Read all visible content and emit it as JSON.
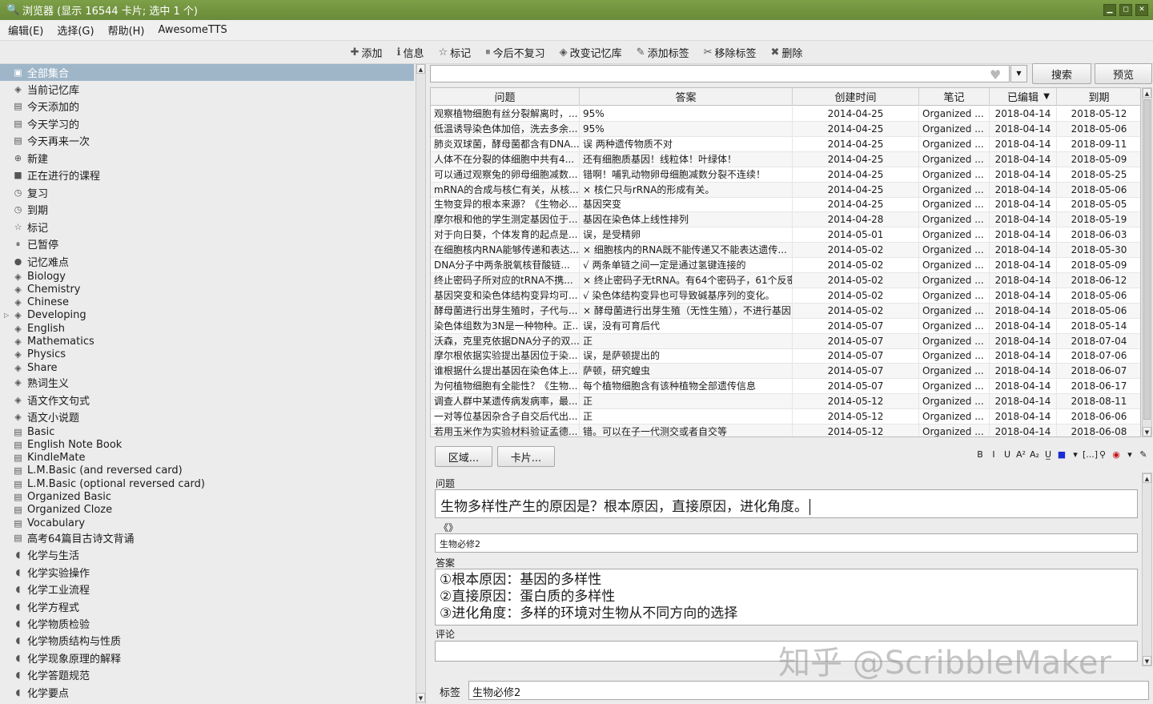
{
  "window": {
    "title": "浏览器 (显示 16544 卡片; 选中 1 个)"
  },
  "menu": [
    "编辑(E)",
    "选择(G)",
    "帮助(H)",
    "AwesomeTTS"
  ],
  "toolbar": [
    {
      "label": "添加",
      "icon": "add-icon",
      "glyph": "✚"
    },
    {
      "label": "信息",
      "icon": "info-icon",
      "glyph": "ℹ"
    },
    {
      "label": "标记",
      "icon": "star-icon",
      "glyph": "☆"
    },
    {
      "label": "今后不复习",
      "icon": "pause-icon",
      "glyph": "⏸"
    },
    {
      "label": "改变记忆库",
      "icon": "deck-icon",
      "glyph": "◈"
    },
    {
      "label": "添加标签",
      "icon": "tag-add-icon",
      "glyph": "✎"
    },
    {
      "label": "移除标签",
      "icon": "tag-remove-icon",
      "glyph": "✂"
    },
    {
      "label": "删除",
      "icon": "delete-icon",
      "glyph": "✖"
    }
  ],
  "sidebar": [
    {
      "label": "全部集合",
      "glyph": "▣",
      "icon": "collection-icon",
      "selected": true
    },
    {
      "label": "当前记忆库",
      "glyph": "◈",
      "icon": "deck-icon"
    },
    {
      "label": "今天添加的",
      "glyph": "▤",
      "icon": "calendar-icon"
    },
    {
      "label": "今天学习的",
      "glyph": "▤",
      "icon": "calendar-icon"
    },
    {
      "label": "今天再来一次",
      "glyph": "▤",
      "icon": "calendar-icon"
    },
    {
      "label": "新建",
      "glyph": "⊕",
      "icon": "new-icon"
    },
    {
      "label": "正在进行的课程",
      "glyph": "■",
      "icon": "course-icon"
    },
    {
      "label": "复习",
      "glyph": "◷",
      "icon": "clock-icon"
    },
    {
      "label": "到期",
      "glyph": "◷",
      "icon": "clock-icon"
    },
    {
      "label": "标记",
      "glyph": "☆",
      "icon": "star-icon"
    },
    {
      "label": "已暂停",
      "glyph": "⏸",
      "icon": "pause-icon"
    },
    {
      "label": "记忆难点",
      "glyph": "●",
      "icon": "leech-icon"
    },
    {
      "label": "Biology",
      "glyph": "◈",
      "icon": "deck-icon"
    },
    {
      "label": "Chemistry",
      "glyph": "◈",
      "icon": "deck-icon"
    },
    {
      "label": "Chinese",
      "glyph": "◈",
      "icon": "deck-icon"
    },
    {
      "label": "Developing",
      "glyph": "◈",
      "icon": "deck-icon",
      "expander": "▷"
    },
    {
      "label": "English",
      "glyph": "◈",
      "icon": "deck-icon"
    },
    {
      "label": "Mathematics",
      "glyph": "◈",
      "icon": "deck-icon"
    },
    {
      "label": "Physics",
      "glyph": "◈",
      "icon": "deck-icon"
    },
    {
      "label": "Share",
      "glyph": "◈",
      "icon": "deck-icon"
    },
    {
      "label": "熟词生义",
      "glyph": "◈",
      "icon": "deck-icon"
    },
    {
      "label": "语文作文句式",
      "glyph": "◈",
      "icon": "deck-icon"
    },
    {
      "label": "语文小说题",
      "glyph": "◈",
      "icon": "deck-icon"
    },
    {
      "label": "Basic",
      "glyph": "▤",
      "icon": "note-type-icon"
    },
    {
      "label": "English Note Book",
      "glyph": "▤",
      "icon": "note-type-icon"
    },
    {
      "label": "KindleMate",
      "glyph": "▤",
      "icon": "note-type-icon"
    },
    {
      "label": "L.M.Basic (and reversed card)",
      "glyph": "▤",
      "icon": "note-type-icon"
    },
    {
      "label": "L.M.Basic (optional reversed card)",
      "glyph": "▤",
      "icon": "note-type-icon"
    },
    {
      "label": "Organized Basic",
      "glyph": "▤",
      "icon": "note-type-icon"
    },
    {
      "label": "Organized Cloze",
      "glyph": "▤",
      "icon": "note-type-icon"
    },
    {
      "label": "Vocabulary",
      "glyph": "▤",
      "icon": "note-type-icon"
    },
    {
      "label": "高考64篇目古诗文背诵",
      "glyph": "▤",
      "icon": "note-type-icon"
    },
    {
      "label": "化学与生活",
      "glyph": "◖",
      "icon": "tag-icon"
    },
    {
      "label": "化学实验操作",
      "glyph": "◖",
      "icon": "tag-icon"
    },
    {
      "label": "化学工业流程",
      "glyph": "◖",
      "icon": "tag-icon"
    },
    {
      "label": "化学方程式",
      "glyph": "◖",
      "icon": "tag-icon"
    },
    {
      "label": "化学物质检验",
      "glyph": "◖",
      "icon": "tag-icon"
    },
    {
      "label": "化学物质结构与性质",
      "glyph": "◖",
      "icon": "tag-icon"
    },
    {
      "label": "化学现象原理的解释",
      "glyph": "◖",
      "icon": "tag-icon"
    },
    {
      "label": "化学答题规范",
      "glyph": "◖",
      "icon": "tag-icon"
    },
    {
      "label": "化学要点",
      "glyph": "◖",
      "icon": "tag-icon"
    }
  ],
  "search": {
    "value": "",
    "search_label": "搜索",
    "preview_label": "预览"
  },
  "table": {
    "columns": [
      "问题",
      "答案",
      "创建时间",
      "笔记",
      "已编辑",
      "到期"
    ],
    "sort_indicator": "▼",
    "rows": [
      [
        "观察植物细胞有丝分裂解离时，...",
        "95%",
        "2014-04-25",
        "Organized ...",
        "2018-04-14",
        "2018-05-12"
      ],
      [
        "低温诱导染色体加倍，洗去多余...",
        "95%",
        "2014-04-25",
        "Organized ...",
        "2018-04-14",
        "2018-05-06"
      ],
      [
        "肺炎双球菌，酵母菌都含有DNA...",
        "误 两种遗传物质不对",
        "2014-04-25",
        "Organized ...",
        "2018-04-14",
        "2018-09-11"
      ],
      [
        "人体不在分裂的体细胞中共有4...",
        "还有细胞质基因！线粒体！叶绿体！",
        "2014-04-25",
        "Organized ...",
        "2018-04-14",
        "2018-05-09"
      ],
      [
        "可以通过观察兔的卵母细胞减数...",
        "错啊！哺乳动物卵母细胞减数分裂不连续！",
        "2014-04-25",
        "Organized ...",
        "2018-04-14",
        "2018-05-25"
      ],
      [
        "mRNA的合成与核仁有关，从核...",
        "× 核仁只与rRNA的形成有关。",
        "2014-04-25",
        "Organized ...",
        "2018-04-14",
        "2018-05-06"
      ],
      [
        "生物变异的根本来源？《生物必...",
        "基因突变",
        "2014-04-25",
        "Organized ...",
        "2018-04-14",
        "2018-05-05"
      ],
      [
        "摩尔根和他的学生测定基因位于...",
        "基因在染色体上线性排列",
        "2014-04-28",
        "Organized ...",
        "2018-04-14",
        "2018-05-19"
      ],
      [
        "对于向日葵，个体发育的起点是...",
        "误，是受精卵",
        "2014-05-01",
        "Organized ...",
        "2018-04-14",
        "2018-06-03"
      ],
      [
        "在细胞核内RNA能够传递和表达...",
        "× 细胞核内的RNA既不能传递又不能表达遗传...",
        "2014-05-02",
        "Organized ...",
        "2018-04-14",
        "2018-05-30"
      ],
      [
        "DNA分子中两条脱氧核苷酸链...",
        "√ 两条单链之间一定是通过氢键连接的",
        "2014-05-02",
        "Organized ...",
        "2018-04-14",
        "2018-05-09"
      ],
      [
        "终止密码子所对应的tRNA不携...",
        "× 终止密码子无tRNA。有64个密码子，61个反密...",
        "2014-05-02",
        "Organized ...",
        "2018-04-14",
        "2018-06-12"
      ],
      [
        "基因突变和染色体结构变异均可...",
        "√ 染色体结构变异也可导致碱基序列的变化。",
        "2014-05-02",
        "Organized ...",
        "2018-04-14",
        "2018-05-06"
      ],
      [
        "酵母菌进行出芽生殖时，子代与...",
        "× 酵母菌进行出芽生殖（无性生殖），不进行基因...",
        "2014-05-02",
        "Organized ...",
        "2018-04-14",
        "2018-05-06"
      ],
      [
        "染色体组数为3N是一种物种。正...",
        "误，没有可育后代",
        "2014-05-07",
        "Organized ...",
        "2018-04-14",
        "2018-05-14"
      ],
      [
        "沃森，克里克依据DNA分子的双...",
        "正",
        "2014-05-07",
        "Organized ...",
        "2018-04-14",
        "2018-07-04"
      ],
      [
        "摩尔根依据实验提出基因位于染...",
        "误，是萨顿提出的",
        "2014-05-07",
        "Organized ...",
        "2018-04-14",
        "2018-07-06"
      ],
      [
        "谁根据什么提出基因在染色体上...",
        "萨顿，研究蝗虫",
        "2014-05-07",
        "Organized ...",
        "2018-04-14",
        "2018-06-07"
      ],
      [
        "为何植物细胞有全能性？《生物...",
        "每个植物细胞含有该种植物全部遗传信息",
        "2014-05-07",
        "Organized ...",
        "2018-04-14",
        "2018-06-17"
      ],
      [
        "调查人群中某遗传病发病率，最...",
        "正",
        "2014-05-12",
        "Organized ...",
        "2018-04-14",
        "2018-08-11"
      ],
      [
        "一对等位基因杂合子自交后代出...",
        "正",
        "2014-05-12",
        "Organized ...",
        "2018-04-14",
        "2018-06-06"
      ],
      [
        "若用玉米作为实验材料验证孟德...",
        "错。可以在子一代测交或者自交等",
        "2014-05-12",
        "Organized ...",
        "2018-04-14",
        "2018-06-08"
      ]
    ]
  },
  "editor": {
    "fields_btn": "区域...",
    "cards_btn": "卡片...",
    "format_tools": [
      "B",
      "I",
      "U",
      "A²",
      "A₂",
      "U̲",
      "■",
      "▾",
      "[...]",
      "⚲",
      "◉",
      "▾",
      "✎"
    ],
    "question_label": "问题",
    "question_value": "生物多样性产生的原因是？根本原因，直接原因，进化角度。",
    "source_label": "《》",
    "source_value": "生物必修2",
    "answer_label": "答案",
    "answer_lines": [
      "①根本原因：基因的多样性",
      "②直接原因：蛋白质的多样性",
      "③进化角度：多样的环境对生物从不同方向的选择"
    ],
    "comment_label": "评论",
    "comment_value": "",
    "tags_label": "标签",
    "tags_value": "生物必修2"
  },
  "watermark": "知乎 @ScribbleMaker"
}
